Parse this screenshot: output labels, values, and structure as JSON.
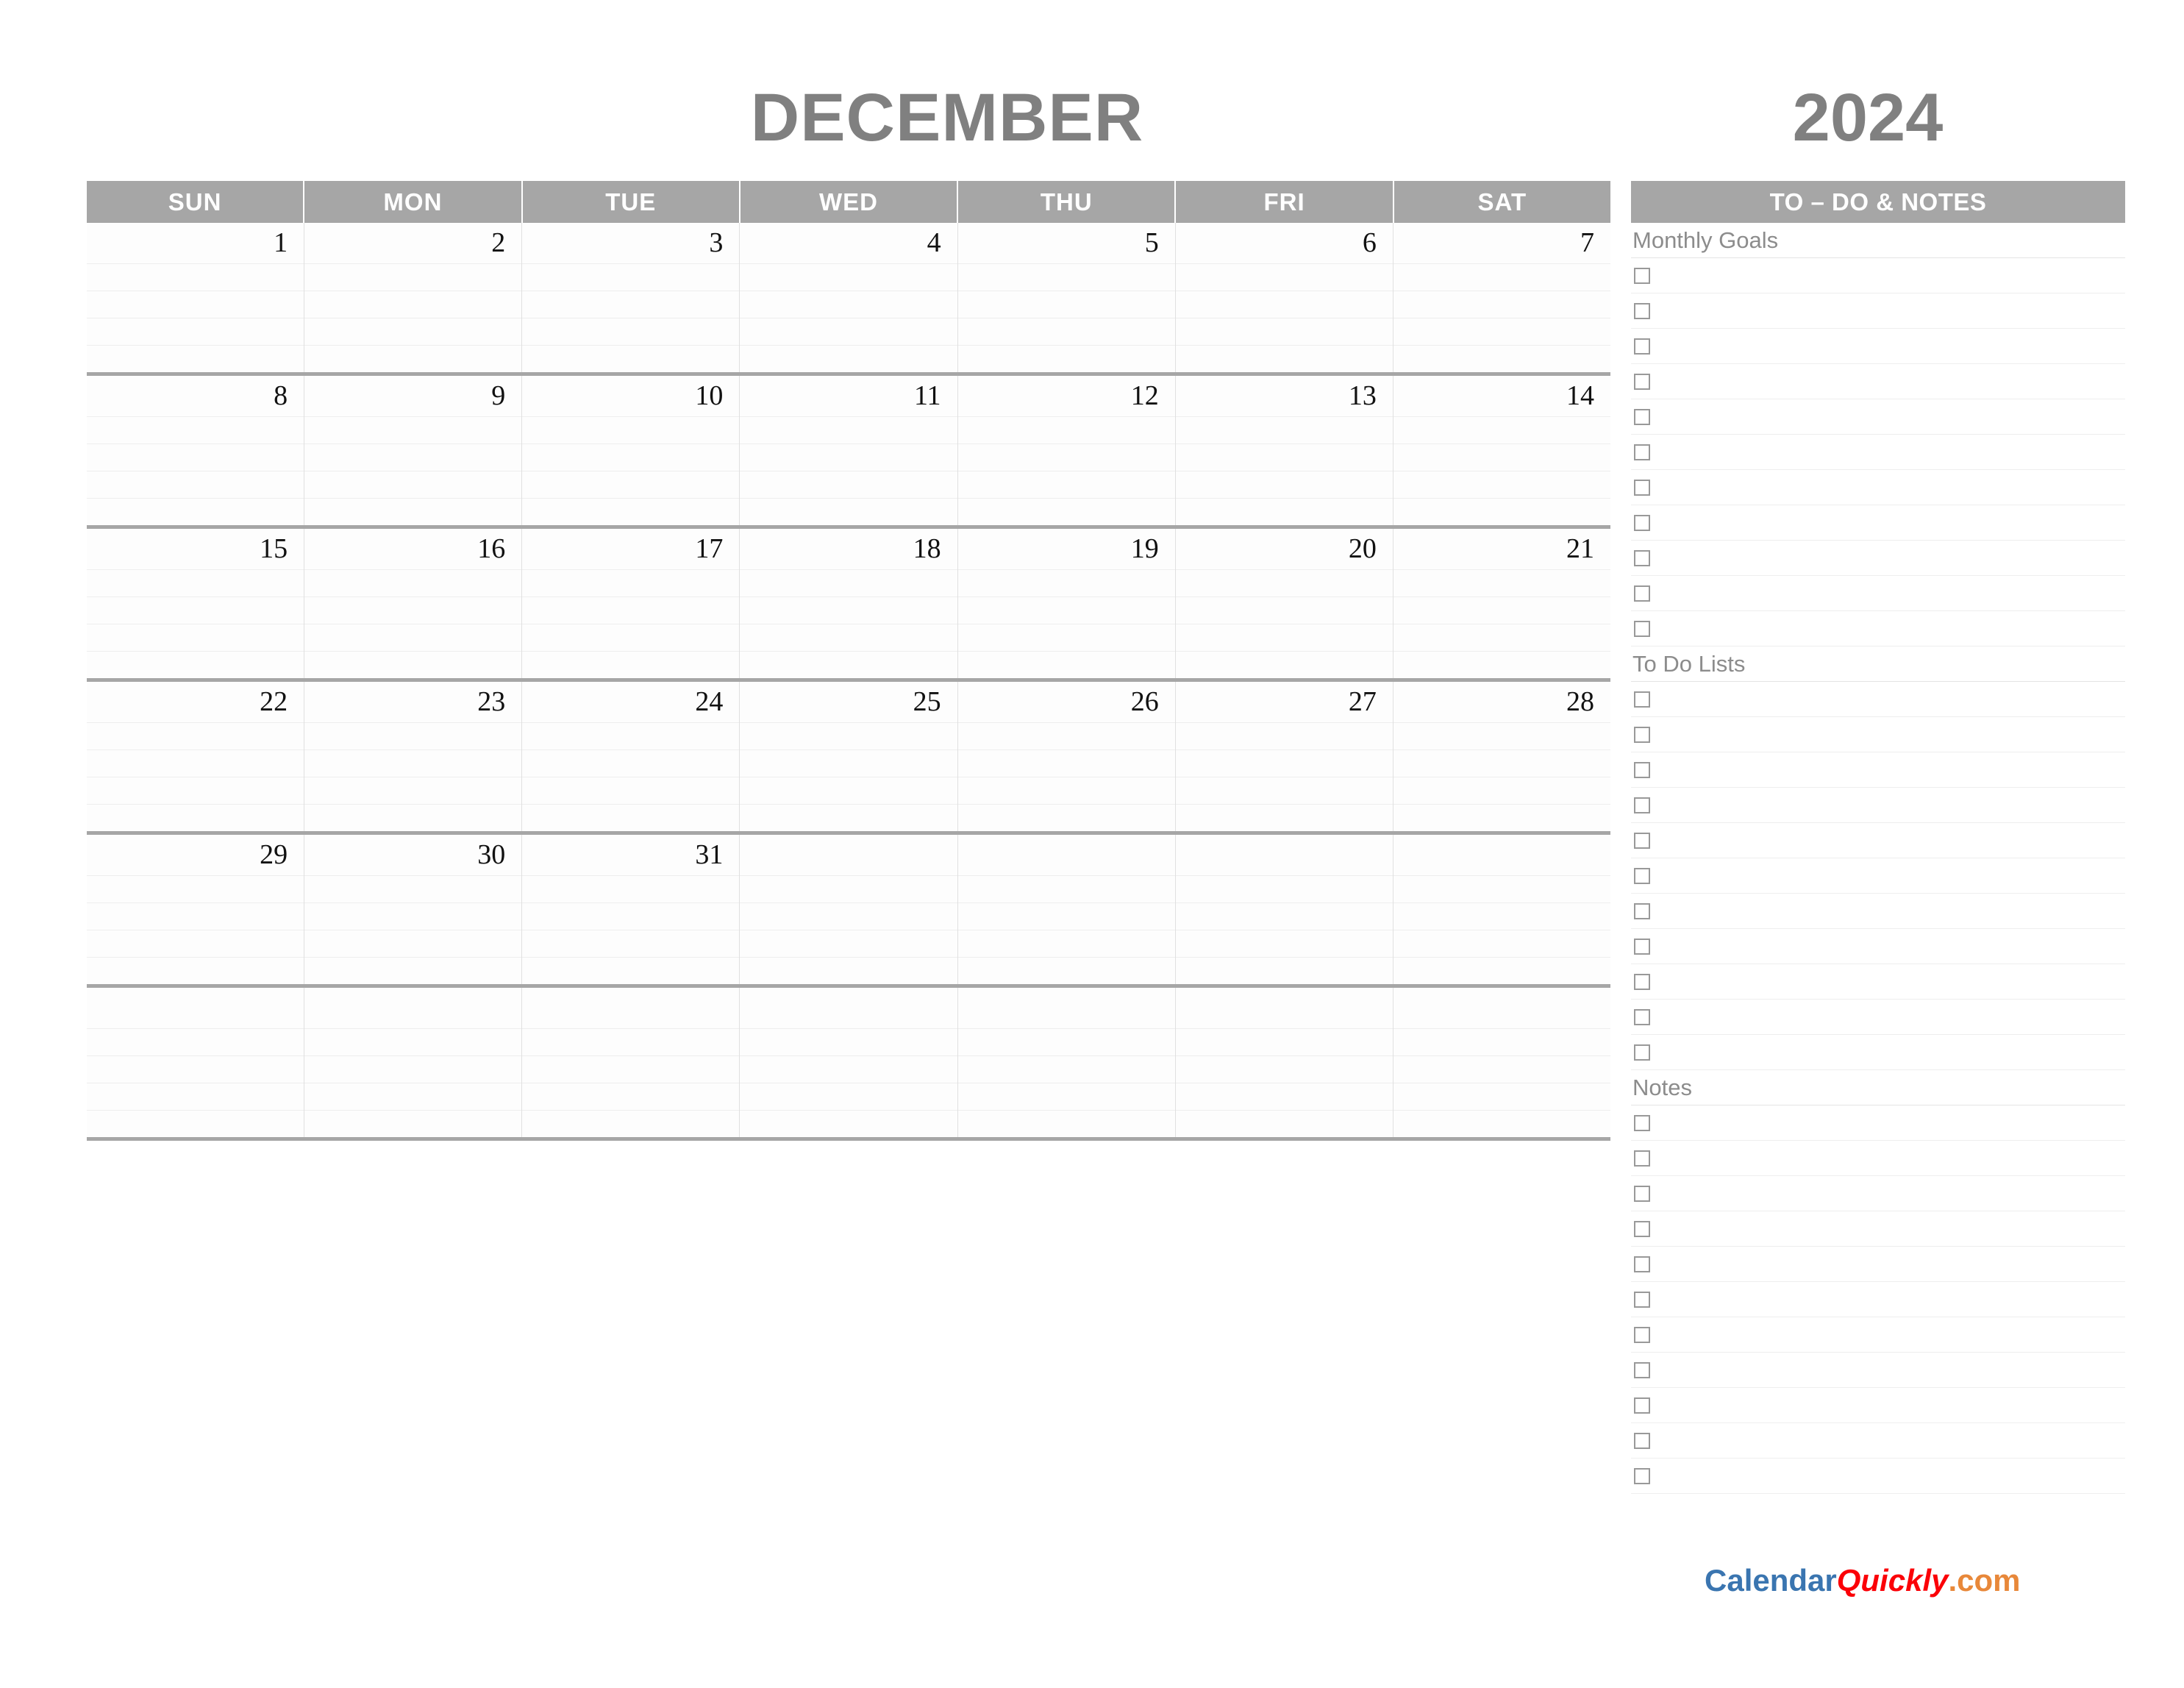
{
  "header": {
    "month": "DECEMBER",
    "year": "2024"
  },
  "calendar": {
    "weekdays": [
      "SUN",
      "MON",
      "TUE",
      "WED",
      "THU",
      "FRI",
      "SAT"
    ],
    "weeks": [
      [
        "1",
        "2",
        "3",
        "4",
        "5",
        "6",
        "7"
      ],
      [
        "8",
        "9",
        "10",
        "11",
        "12",
        "13",
        "14"
      ],
      [
        "15",
        "16",
        "17",
        "18",
        "19",
        "20",
        "21"
      ],
      [
        "22",
        "23",
        "24",
        "25",
        "26",
        "27",
        "28"
      ],
      [
        "29",
        "30",
        "31",
        "",
        "",
        "",
        ""
      ],
      [
        "",
        "",
        "",
        "",
        "",
        "",
        ""
      ]
    ],
    "lines_per_day": 4,
    "lines_last_row": 5
  },
  "sidebar": {
    "title": "TO – DO & NOTES",
    "sections": [
      {
        "label": "Monthly Goals",
        "rows": 11
      },
      {
        "label": "To Do Lists",
        "rows": 11
      },
      {
        "label": "Notes",
        "rows": 11
      }
    ]
  },
  "logo": {
    "part1": "Calendar",
    "part2": "Quickly",
    "part3": ".com"
  },
  "colors": {
    "header_gray": "#a6a6a6",
    "title_gray": "#808080",
    "label_gray": "#8c8c8c",
    "line_light": "#eeeeee",
    "logo_blue": "#3a75b0",
    "logo_red": "#fb0007",
    "logo_orange": "#e8883a"
  }
}
